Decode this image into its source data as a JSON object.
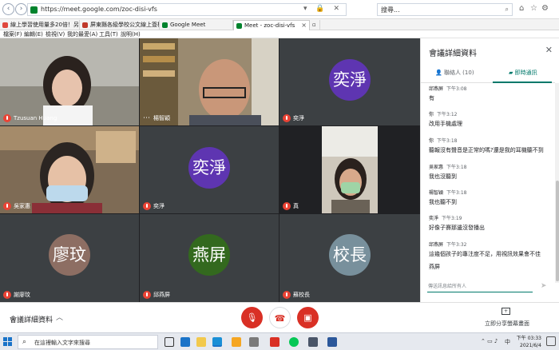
{
  "browser": {
    "url": "https://meet.google.com/zoc-disi-vfs",
    "search_placeholder": "搜尋...",
    "tabs": [
      {
        "label": "線上學習使用量多20倍！另一...",
        "color": "#e0483e"
      },
      {
        "label": "屏東縣各級學校公文線上簽核...",
        "color": "#c0392b"
      },
      {
        "label": "Google Meet",
        "color": "#00832d"
      },
      {
        "label": "Meet - zoc-disi-vfs",
        "color": "#00832d"
      }
    ],
    "menu": [
      "檔案(F)",
      "編輯(E)",
      "檢視(V)",
      "我的最愛(A)",
      "工具(T)",
      "說明(H)"
    ]
  },
  "participants": [
    {
      "name": "Tzusuan Huang",
      "kind": "video",
      "muted": true
    },
    {
      "name": "楊智穎",
      "kind": "video",
      "muted": false
    },
    {
      "name": "奕淨",
      "kind": "avatar",
      "initial": "奕淨",
      "color": "#5e35b1",
      "muted": true
    },
    {
      "name": "吳家惠",
      "kind": "video",
      "muted": true
    },
    {
      "name": "奕淨",
      "kind": "avatar",
      "initial": "奕淨",
      "color": "#5e35b1",
      "muted": true
    },
    {
      "name": "真",
      "kind": "video",
      "muted": true
    },
    {
      "name": "謝廖玟",
      "kind": "avatar",
      "initial": "廖玟",
      "color": "#8d6e63",
      "muted": true
    },
    {
      "name": "邱燕屏",
      "kind": "avatar",
      "initial": "燕屏",
      "color": "#33691e",
      "muted": true
    },
    {
      "name": "蘇校長",
      "kind": "avatar",
      "initial": "校長",
      "color": "#78909c",
      "muted": true
    }
  ],
  "panel": {
    "title": "會議詳細資料",
    "tab_people": "聯絡人 (10)",
    "tab_chat": "即時通訊",
    "messages": [
      {
        "sender": "邱燕屏",
        "time": "下午3:08",
        "text": "有"
      },
      {
        "sender": "你",
        "time": "下午3:12",
        "text": "改用手機處理"
      },
      {
        "sender": "你",
        "time": "下午3:18",
        "text": "聽報沒有聲音是正常的嗎?還是我的耳機聽不到"
      },
      {
        "sender": "吳家惠",
        "time": "下午3:18",
        "text": "我也沒聽到"
      },
      {
        "sender": "楊智穎",
        "time": "下午3:18",
        "text": "我也聽不到"
      },
      {
        "sender": "奕淨",
        "time": "下午3:19",
        "text": "好像子賽那邊沒發播出"
      },
      {
        "sender": "邱燕屏",
        "time": "下午3:32",
        "text": "這幾個孩子的專注度不足，用視訊效果會不佳"
      },
      {
        "sender": "",
        "time": "",
        "text": "燕屏"
      }
    ],
    "input_placeholder": "傳送訊息給所有人"
  },
  "bottom": {
    "meeting_details": "會議詳細資料",
    "present_label": "立即分享螢幕畫面"
  },
  "taskbar": {
    "search_placeholder": "在這裡輸入文字來搜尋",
    "time": "下午 03:33",
    "date": "2021/6/4",
    "ime": "中"
  }
}
